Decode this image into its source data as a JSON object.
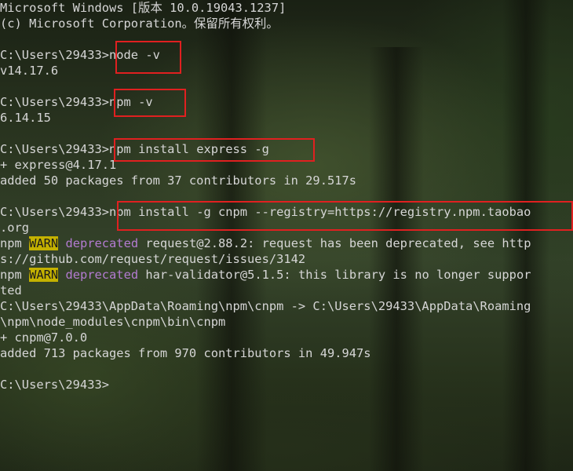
{
  "terminal": {
    "header": {
      "line1": "Microsoft Windows [版本 10.0.19043.1237]",
      "line2": "(c) Microsoft Corporation。保留所有权利。"
    },
    "prompt": "C:\\Users\\29433>",
    "cmd_node": "node -v",
    "out_node": "v14.17.6",
    "cmd_npm": "npm -v",
    "out_npm": "6.14.15",
    "cmd_express": "npm install express -g",
    "out_express_1": "+ express@4.17.1",
    "out_express_2": "added 50 packages from 37 contributors in 29.517s",
    "cmd_cnpm": "npm install -g cnpm --registry=https://registry.npm.taobao",
    "cmd_cnpm_wrap": ".org",
    "npm_label": "npm ",
    "warn_label": "WARN",
    "deprecated_label": "deprecated",
    "warn1_text": " request@2.88.2: request has been deprecated, see http",
    "warn1_wrap": "s://github.com/request/request/issues/3142",
    "warn2_text": " har-validator@5.1.5: this library is no longer suppor",
    "warn2_wrap": "ted",
    "link_line1": "C:\\Users\\29433\\AppData\\Roaming\\npm\\cnpm -> C:\\Users\\29433\\AppData\\Roaming",
    "link_line2": "\\npm\\node_modules\\cnpm\\bin\\cnpm",
    "out_cnpm_1": "+ cnpm@7.0.0",
    "out_cnpm_2": "added 713 packages from 970 contributors in 49.947s",
    "final_prompt": "C:\\Users\\29433>"
  },
  "colors": {
    "text": "#d6d6d6",
    "highlight_box": "#e02020",
    "warn_bg": "#c4b100",
    "deprecated": "#b37bd1"
  }
}
